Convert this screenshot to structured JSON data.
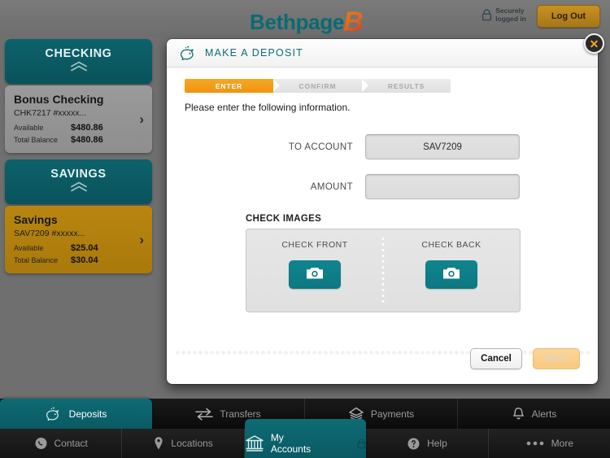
{
  "header": {
    "logo_text": "Bethpage",
    "logo_mark": "B",
    "secure_line1": "Securely",
    "secure_line2": "logged in",
    "lock_icon": "lock-icon",
    "logout_label": "Log Out"
  },
  "sidebar": {
    "groups": [
      {
        "title": "CHECKING",
        "collapse_icon": "chevron-double-up-icon",
        "account": {
          "name": "Bonus Checking",
          "number": "CHK7217 #xxxxx...",
          "available_label": "Available",
          "available_value": "$480.86",
          "total_label": "Total Balance",
          "total_value": "$480.86",
          "arrow_icon": "chevron-right-icon",
          "style": "grey"
        }
      },
      {
        "title": "SAVINGS",
        "collapse_icon": "chevron-double-up-icon",
        "account": {
          "name": "Savings",
          "number": "SAV7209 #xxxxx...",
          "available_label": "Available",
          "available_value": "$25.04",
          "total_label": "Total Balance",
          "total_value": "$30.04",
          "arrow_icon": "chevron-right-icon",
          "style": "gold"
        }
      }
    ]
  },
  "modal": {
    "title": "MAKE A DEPOSIT",
    "title_icon": "piggy-bank-icon",
    "close_icon": "close-x-icon",
    "steps": [
      {
        "label": "ENTER",
        "state": "active"
      },
      {
        "label": "CONFIRM",
        "state": "inactive"
      },
      {
        "label": "RESULTS",
        "state": "inactive"
      }
    ],
    "instruction": "Please enter the following information.",
    "fields": [
      {
        "label": "TO ACCOUNT",
        "value": "SAV7209",
        "placeholder": ""
      },
      {
        "label": "AMOUNT",
        "value": "",
        "placeholder": ""
      }
    ],
    "check_images": {
      "section_title": "CHECK IMAGES",
      "front_label": "CHECK FRONT",
      "back_label": "CHECK BACK",
      "camera_icon": "camera-icon"
    },
    "actions": {
      "cancel_label": "Cancel",
      "next_label": "Next",
      "next_disabled": true
    }
  },
  "nav_primary": [
    {
      "label": "Deposits",
      "icon": "piggy-bank-icon",
      "active": true
    },
    {
      "label": "Transfers",
      "icon": "transfer-arrows-icon",
      "active": false
    },
    {
      "label": "Payments",
      "icon": "payment-stack-icon",
      "active": false
    },
    {
      "label": "Alerts",
      "icon": "bell-icon",
      "active": false
    }
  ],
  "nav_secondary": [
    {
      "label": "Contact",
      "icon": "phone-icon",
      "active": false
    },
    {
      "label": "Locations",
      "icon": "map-pin-icon",
      "active": false
    },
    {
      "label": "My Accounts",
      "icon": "bank-icon",
      "active": true,
      "lock_icon": "lock-icon"
    },
    {
      "label": "Help",
      "icon": "question-icon",
      "active": false
    },
    {
      "label": "More",
      "icon": "ellipsis-icon",
      "active": false
    }
  ],
  "colors": {
    "teal": "#0d6c76",
    "orange": "#f09614",
    "gold": "#b8860f",
    "overlay": "#6f6f6f"
  }
}
